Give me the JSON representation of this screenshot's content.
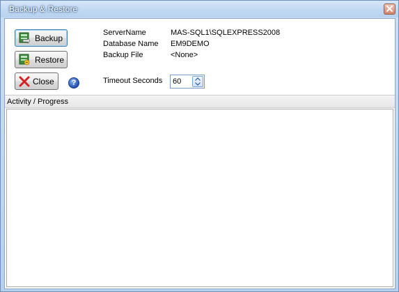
{
  "window": {
    "title": "Backup & Restore"
  },
  "buttons": {
    "backup_label": "Backup",
    "restore_label": "Restore",
    "close_label": "Close"
  },
  "info": {
    "server_label": "ServerName",
    "server_value": "MAS-SQL1\\SQLEXPRESS2008",
    "database_label": "Database Name",
    "database_value": "EM9DEMO",
    "backup_file_label": "Backup File",
    "backup_file_value": "<None>",
    "timeout_label": "Timeout Seconds",
    "timeout_value": "60"
  },
  "activity": {
    "header": "Activity / Progress"
  },
  "icons": {
    "help": "question-mark-icon",
    "close": "close-x-icon",
    "backup": "database-backup-icon",
    "restore": "database-restore-icon"
  },
  "colors": {
    "title_bar": "#c3daf3",
    "close_button": "#d4826b",
    "close_red_x": "#d32020",
    "accent_blue": "#3c7fb1"
  }
}
